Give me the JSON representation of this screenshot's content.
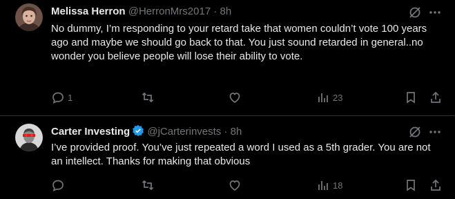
{
  "tweets": [
    {
      "name": "Melissa Herron",
      "handle": "@HerronMrs2017",
      "separator": "·",
      "time": "8h",
      "verified": false,
      "text": "No dummy, I’m responding to your retard take that women couldn’t vote 100 years ago and maybe we should go back to that. You just sound retarded in general..no wonder you believe people will lose their ability to vote.",
      "replies": "1",
      "reposts": "",
      "likes": "",
      "views": "23"
    },
    {
      "name": "Carter Investing",
      "handle": "@jCarterinvests",
      "separator": "·",
      "time": "8h",
      "verified": true,
      "text": "I’ve provided proof. You’ve just repeated a word I used as a 5th grader. You are not an intellect. Thanks for making that obvious",
      "replies": "",
      "reposts": "",
      "likes": "",
      "views": "18"
    }
  ],
  "colors": {
    "background": "#000000",
    "text": "#e7e9ea",
    "muted": "#71767b",
    "verified": "#1d9bf0",
    "divider": "#2f3336"
  },
  "icons": [
    "grok-icon",
    "more-icon",
    "reply-icon",
    "repost-icon",
    "like-icon",
    "views-icon",
    "bookmark-icon",
    "share-icon"
  ]
}
